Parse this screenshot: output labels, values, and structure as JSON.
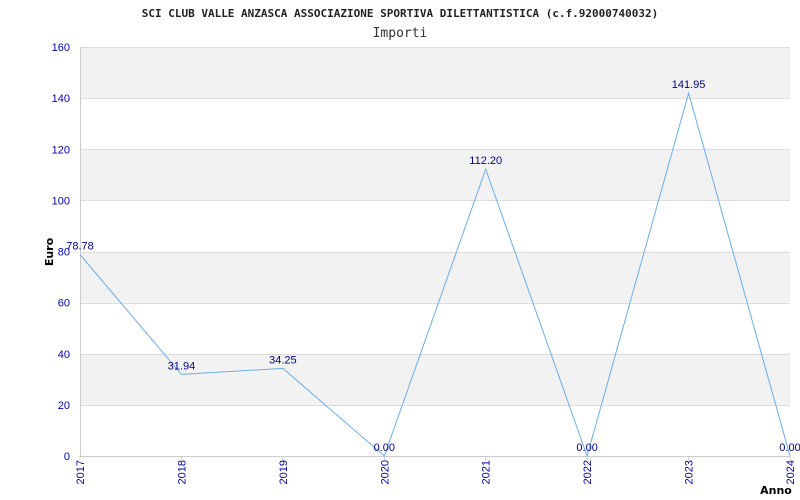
{
  "chart_data": {
    "type": "line",
    "title": "SCI CLUB VALLE ANZASCA ASSOCIAZIONE SPORTIVA DILETTANTISTICA (c.f.92000740032)",
    "subtitle": "Importi",
    "xlabel": "Anno",
    "ylabel": "Euro",
    "categories": [
      "2017",
      "2018",
      "2019",
      "2020",
      "2021",
      "2022",
      "2023",
      "2024"
    ],
    "values": [
      78.78,
      31.94,
      34.25,
      0.0,
      112.2,
      0.0,
      141.95,
      0.0
    ],
    "value_labels": [
      "78.78",
      "31.94",
      "34.25",
      "0.00",
      "112.20",
      "0.00",
      "141.95",
      "0.00"
    ],
    "ylim": [
      0,
      160
    ],
    "yticks": [
      "0",
      "20",
      "40",
      "60",
      "80",
      "100",
      "120",
      "140",
      "160"
    ],
    "grid": true,
    "colors": {
      "line": "#6aaeea",
      "band": "#f2f2f2",
      "tick_text": "#0000aa",
      "value_text": "#000088"
    }
  }
}
